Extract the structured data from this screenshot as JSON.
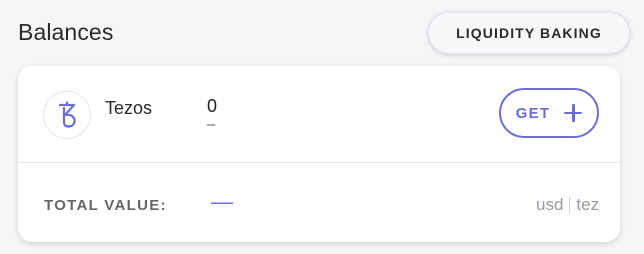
{
  "header": {
    "title": "Balances",
    "liquidity_button_label": "LIQUIDITY BAKING"
  },
  "asset": {
    "name": "Tezos",
    "icon": "tezos-icon",
    "balance": "0",
    "fiat_balance": "–",
    "get_label": "GET",
    "get_icon": "plus-icon"
  },
  "total": {
    "label": "TOTAL VALUE:",
    "value": "—"
  },
  "currency": {
    "usd_label": "usd",
    "tez_label": "tez"
  },
  "colors": {
    "accent": "#6b6fd0",
    "background": "#f5f6f8",
    "card": "#ffffff"
  }
}
